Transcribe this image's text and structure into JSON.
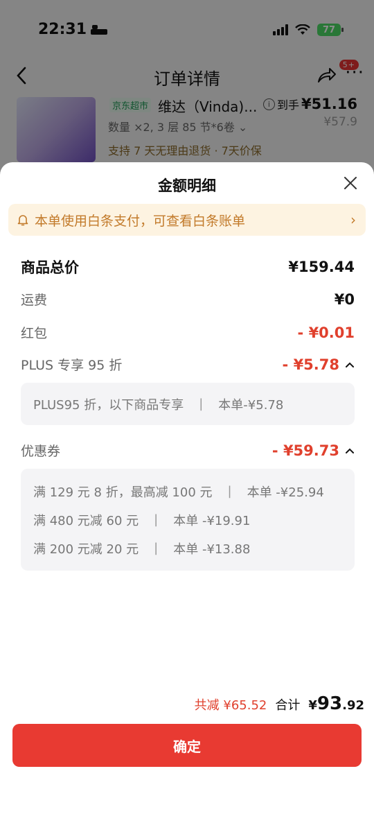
{
  "status": {
    "time": "22:31",
    "battery": "77"
  },
  "nav": {
    "title": "订单详情",
    "badge": "5+"
  },
  "product": {
    "tag": "京东超市",
    "name": "维达（Vinda)...",
    "qty": "数量 ×2, 3 层 85 节*6卷 ⌄",
    "service": "支持 7 天无理由退货 · 7天价保",
    "price_label": "到手",
    "price": "¥51.16",
    "orig_price": "¥57.9"
  },
  "sheet": {
    "title": "金额明细",
    "notice": "本单使用白条支付，可查看白条账单"
  },
  "rows": {
    "total_label": "商品总价",
    "total_val": "¥159.44",
    "shipping_label": "运费",
    "shipping_val": "¥0",
    "redpack_label": "红包",
    "redpack_val": "- ¥0.01",
    "plus_label": "PLUS 专享 95 折",
    "plus_val": "- ¥5.78",
    "coupon_label": "优惠券",
    "coupon_val": "- ¥59.73"
  },
  "plus_detail": {
    "desc": "PLUS95 折，以下商品专享",
    "sep": "|",
    "amount": "本单-¥5.78"
  },
  "coupons": [
    {
      "desc": "满 129 元 8 折，最高减 100 元",
      "sep": "|",
      "amount": "本单 -¥25.94"
    },
    {
      "desc": "满 480 元减 60 元",
      "sep": "|",
      "amount": "本单 -¥19.91"
    },
    {
      "desc": "满 200 元减 20 元",
      "sep": "|",
      "amount": "本单 -¥13.88"
    }
  ],
  "summary": {
    "saved": "共减 ¥65.52",
    "total_label": "合计",
    "total_currency": "¥",
    "total_int": "93",
    "total_dec": ".92"
  },
  "confirm": "确定",
  "colors": {
    "accent_red": "#e83a32",
    "notice_bg": "#fdf3e1",
    "notice_text": "#c27a2a"
  }
}
